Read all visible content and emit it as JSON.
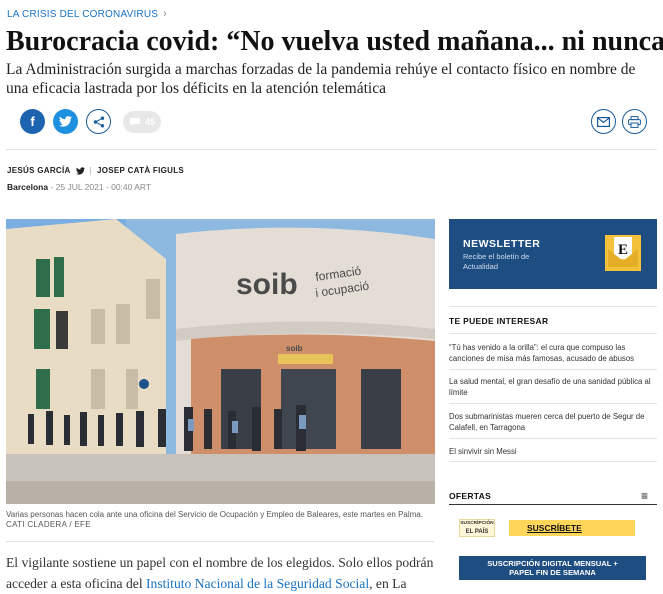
{
  "kicker": {
    "label": "LA CRISIS DEL CORONAVIRUS",
    "chevron": "›"
  },
  "article": {
    "headline": "Burocracia covid: “No vuelva usted mañana... ni nunca”",
    "subhead": "La Administración surgida a marchas forzadas de la pandemia rehúye el contacto físico en nombre de una eficacia lastrada por los déficits en la atención telemática",
    "comment_count": "45",
    "authors": [
      "JESÚS GARCÍA",
      "JOSEP CATÀ FIGULS"
    ],
    "author_divider": "|",
    "location": "Barcelona",
    "date": " - 25 JUL 2021 - 00:40 ART",
    "photo_caption": "Varias personas hacen cola ante una oficina del Servicio de Ocupación y Empleo de Baleares, este martes en Palma.",
    "photo_credit": "CATI CLADERA / EFE",
    "photo_sign_main": "soib",
    "photo_sign_sub1": "formació",
    "photo_sign_sub2": "i ocupació",
    "photo_sign_small": "soib",
    "body_part1": "El vigilante sostiene un papel con el nombre de los elegidos. Solo ellos podrán acceder a esta oficina del ",
    "body_link": "Instituto Nacional de la Seguridad Social",
    "body_part2": ", en La"
  },
  "icons": {
    "facebook": "f",
    "share_count_icon": "speech-bubble"
  },
  "sidebar": {
    "newsletter_title": "NEWSLETTER",
    "newsletter_sub": "Recibe el boletín de Actualidad",
    "envelope_letter": "E",
    "suggest_heading": "TE PUEDE INTERESAR",
    "suggest_items": [
      "“Tú has venido a la orilla”: el cura que compuso las canciones de misa más famosas, acusado de abusos",
      "La salud mental, el gran desafío de una sanidad pública al límite",
      "Dos submarinistas mueren cerca del puerto de Segur de Calafell, en Tarragona",
      "El sinvivir sin Messi"
    ],
    "offers_heading": "OFERTAS",
    "offers_menu": "≡",
    "elpais_logo_line1": "SUSCRÍPCIÓN",
    "elpais_logo_line2": "EL PAÍS",
    "subscribe_label": "SUSCRÍBETE",
    "plan_line1": "SUSCRIPCIÓN DIGITAL MENSUAL +",
    "plan_line2": "PAPEL FIN DE SEMANA"
  },
  "colors": {
    "accent": "#1a73c2",
    "navy": "#1e4d82",
    "yellow": "#ffd65a"
  }
}
